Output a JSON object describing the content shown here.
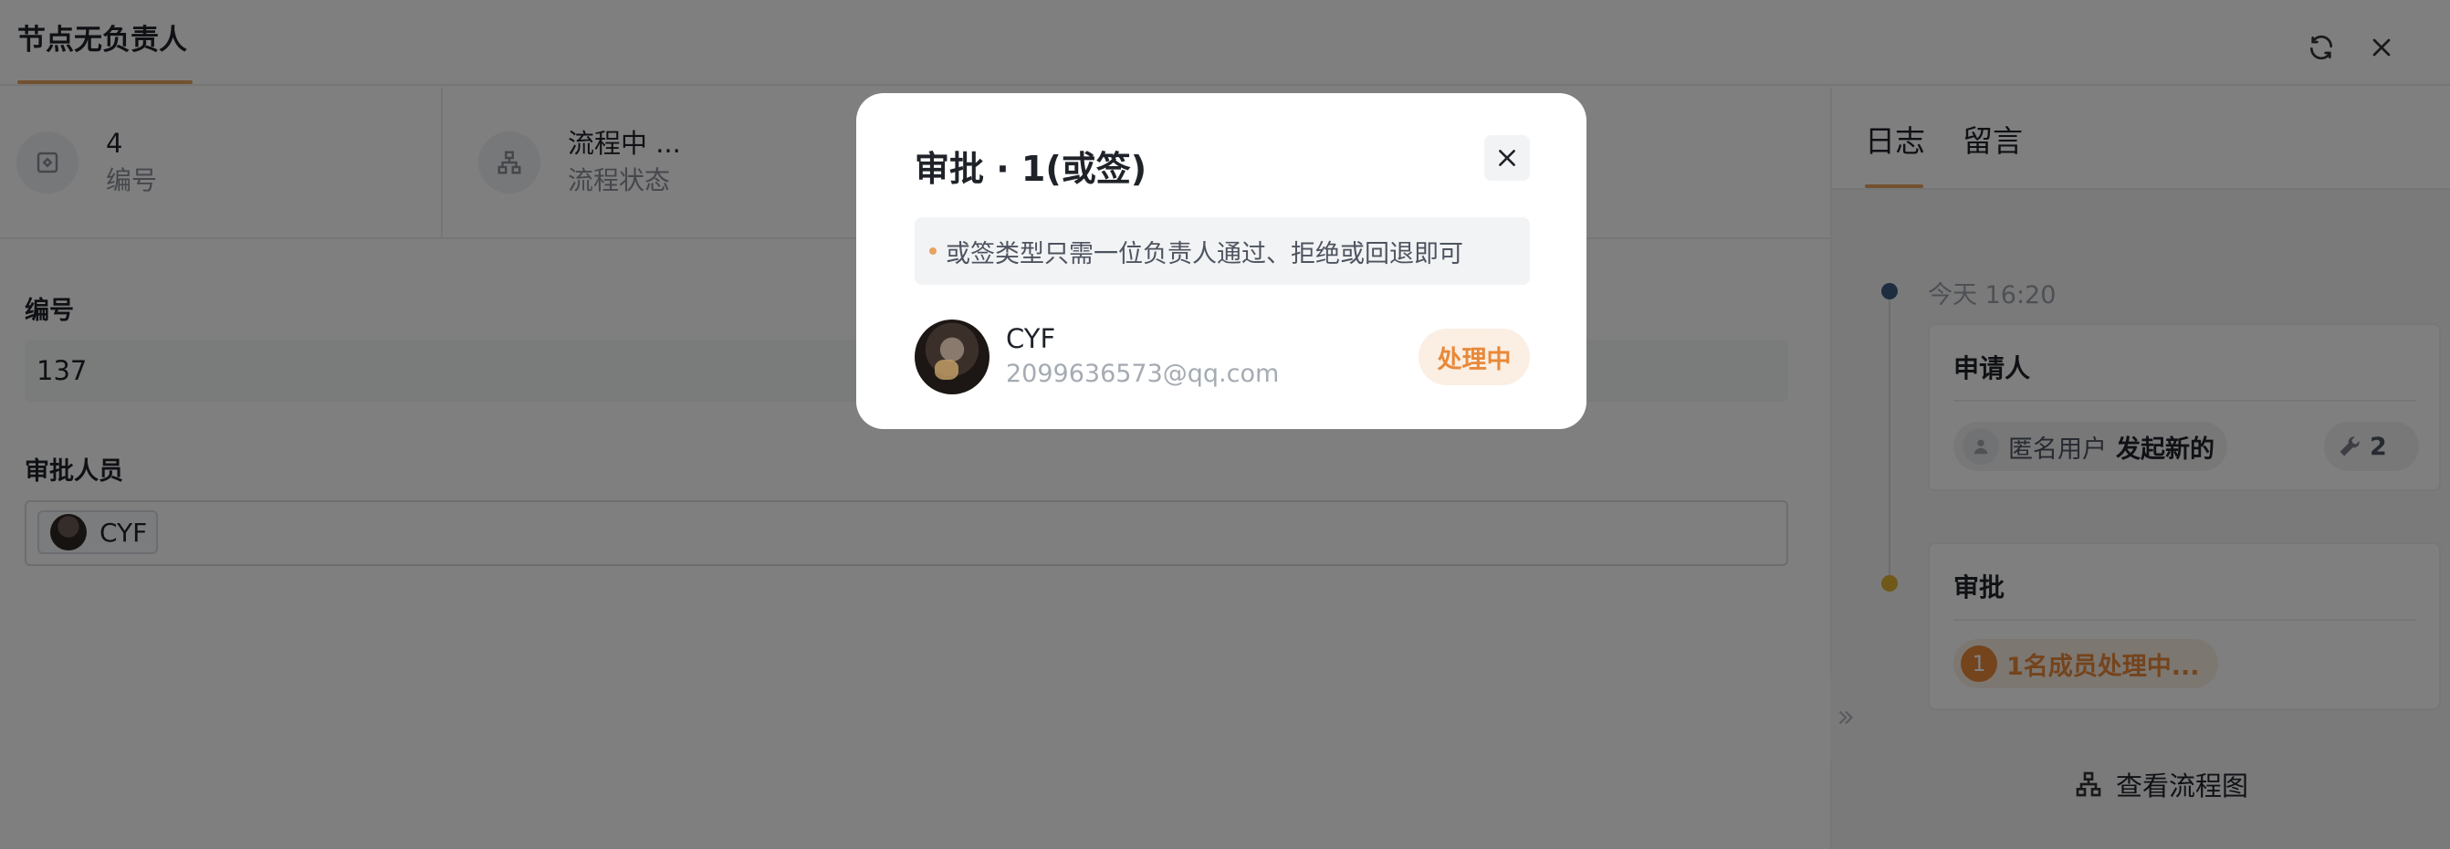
{
  "header": {
    "title": "节点无负责人"
  },
  "info": [
    {
      "value": "4",
      "label": "编号",
      "icon": "ticket-icon"
    },
    {
      "value": "流程中 ...",
      "label": "流程状态",
      "icon": "org-chart-icon"
    }
  ],
  "form": {
    "number_label": "编号",
    "number_value": "137",
    "approvers_label": "审批人员",
    "approver_tag": "CYF"
  },
  "right_panel": {
    "tabs": [
      "日志",
      "留言"
    ],
    "timestamp": "今天 16:20",
    "card1": {
      "title": "申请人",
      "pill_user": "匿名用户",
      "pill_action": "发起新的",
      "tool_count": "2"
    },
    "card2": {
      "title": "审批",
      "member_count": "1",
      "pill_text": "1名成员处理中..."
    },
    "view_flow": "查看流程图"
  },
  "modal": {
    "title": "审批 · 1(或签)",
    "hint": "或签类型只需一位负责人通过、拒绝或回退即可",
    "member": {
      "name": "CYF",
      "email": "2099636573@qq.com",
      "status": "处理中"
    }
  },
  "colors": {
    "accent": "#e8a25f",
    "dot_blue": "#3d5a80",
    "dot_yellow": "#e0b030",
    "pending": "#e8893a"
  }
}
